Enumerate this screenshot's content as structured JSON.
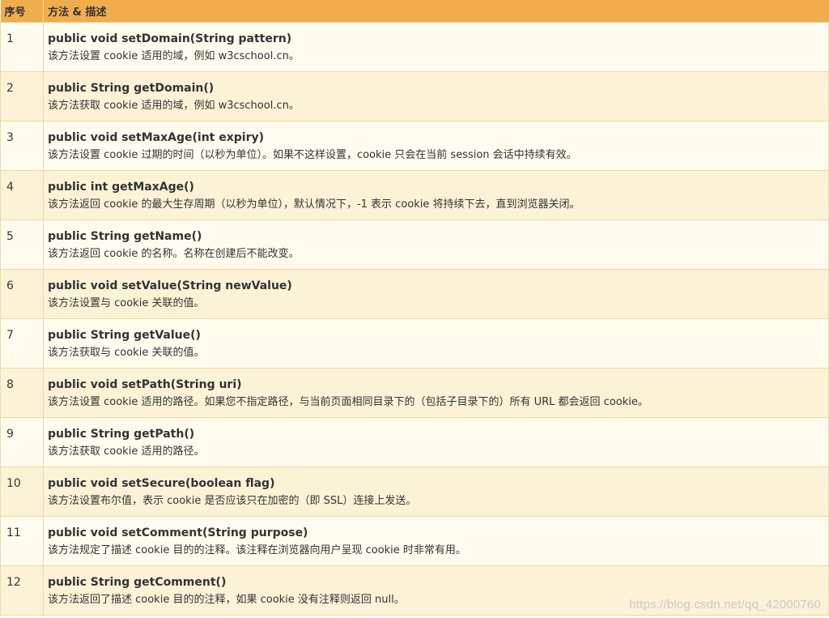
{
  "table": {
    "header": {
      "index_label": "序号",
      "method_label": "方法 & 描述"
    },
    "rows": [
      {
        "index": "1",
        "method": "public void setDomain(String pattern)",
        "description": "该方法设置 cookie 适用的域，例如 w3cschool.cn。"
      },
      {
        "index": "2",
        "method": "public String getDomain()",
        "description": "该方法获取 cookie 适用的域，例如 w3cschool.cn。"
      },
      {
        "index": "3",
        "method": "public void setMaxAge(int expiry)",
        "description": "该方法设置 cookie 过期的时间（以秒为单位）。如果不这样设置，cookie 只会在当前 session 会话中持续有效。"
      },
      {
        "index": "4",
        "method": "public int getMaxAge()",
        "description": "该方法返回 cookie 的最大生存周期（以秒为单位），默认情况下，-1 表示 cookie 将持续下去，直到浏览器关闭。"
      },
      {
        "index": "5",
        "method": "public String getName()",
        "description": "该方法返回 cookie 的名称。名称在创建后不能改变。"
      },
      {
        "index": "6",
        "method": "public void setValue(String newValue)",
        "description": "该方法设置与 cookie 关联的值。"
      },
      {
        "index": "7",
        "method": "public String getValue()",
        "description": "该方法获取与 cookie 关联的值。"
      },
      {
        "index": "8",
        "method": "public void setPath(String uri)",
        "description": "该方法设置 cookie 适用的路径。如果您不指定路径，与当前页面相同目录下的（包括子目录下的）所有 URL 都会返回 cookie。"
      },
      {
        "index": "9",
        "method": "public String getPath()",
        "description": "该方法获取 cookie 适用的路径。"
      },
      {
        "index": "10",
        "method": "public void setSecure(boolean flag)",
        "description": "该方法设置布尔值，表示 cookie 是否应该只在加密的（即 SSL）连接上发送。"
      },
      {
        "index": "11",
        "method": "public void setComment(String purpose)",
        "description": "该方法规定了描述 cookie 目的的注释。该注释在浏览器向用户呈现 cookie 时非常有用。"
      },
      {
        "index": "12",
        "method": "public String getComment()",
        "description": "该方法返回了描述 cookie 目的的注释，如果 cookie 没有注释则返回 null。"
      }
    ]
  },
  "watermark": "https://blog.csdn.net/qq_42000760",
  "colors": {
    "header_bg": "#f0ad4e",
    "row_odd_bg": "#fffcee",
    "row_even_bg": "#fcf3d6"
  }
}
